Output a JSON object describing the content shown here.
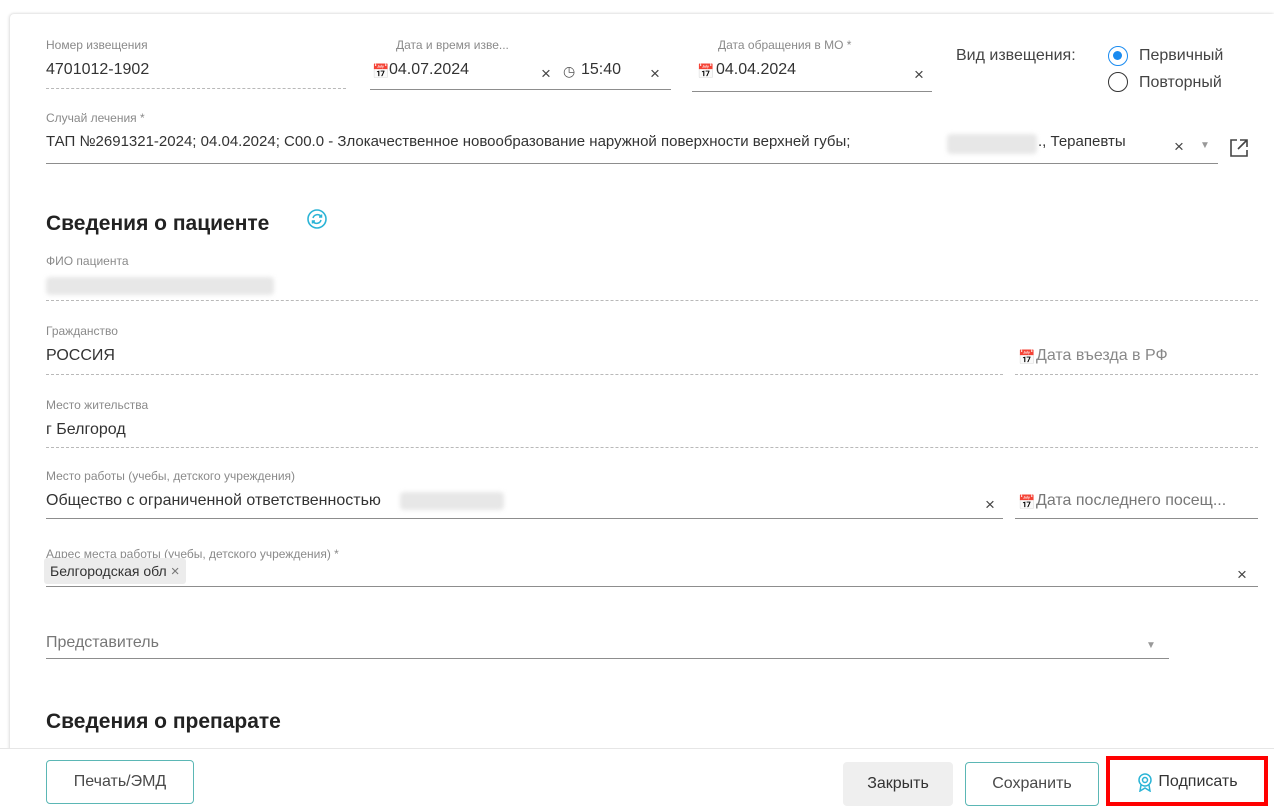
{
  "notice": {
    "number": {
      "label": "Номер извещения",
      "value": "4701012-1902"
    },
    "datetime": {
      "label": "Дата и время изве...",
      "date": "04.07.2024",
      "time": "15:40"
    },
    "visit_date": {
      "label": "Дата обращения в МО *",
      "value": "04.04.2024"
    },
    "type": {
      "label": "Вид извещения:",
      "options": [
        {
          "label": "Первичный",
          "selected": true
        },
        {
          "label": "Повторный",
          "selected": false
        }
      ]
    },
    "case": {
      "label": "Случай лечения *",
      "value_left": "ТАП №2691321-2024; 04.04.2024; C00.0 - Злокачественное новообразование наружной поверхности верхней губы;",
      "value_right": "., Терапевты"
    }
  },
  "patient": {
    "title": "Сведения о пациенте",
    "fio_label": "ФИО пациента",
    "citizenship": {
      "label": "Гражданство",
      "value": "РОССИЯ"
    },
    "entry_date": {
      "placeholder": "Дата въезда в РФ"
    },
    "residence": {
      "label": "Место жительства",
      "value": "г Белгород"
    },
    "workplace": {
      "label": "Место работы (учебы, детского учреждения)",
      "value": "Общество с ограниченной ответственностью"
    },
    "last_visit": {
      "placeholder": "Дата последнего посещ..."
    },
    "work_address": {
      "label": "Адрес места работы (учебы, детского учреждения) *",
      "chip": "Белгородская обл"
    },
    "representative": {
      "placeholder": "Представитель"
    }
  },
  "drug_section": {
    "title": "Сведения о препарате"
  },
  "footer": {
    "print_label": "Печать/ЭМД",
    "close_label": "Закрыть",
    "save_label": "Сохранить",
    "sign_label": "Подписать"
  },
  "colors": {
    "accent": "#1a8bf0",
    "teal": "#5bb7b5",
    "highlight": "#ff0000"
  }
}
